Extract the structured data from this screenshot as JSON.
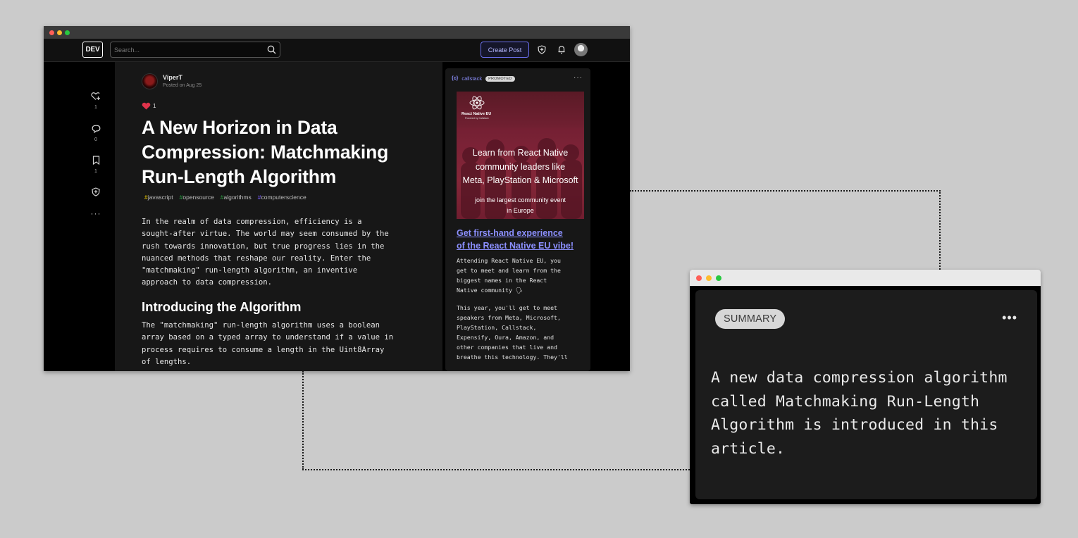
{
  "browser": {
    "nav": {
      "logo": "DEV",
      "search_placeholder": "Search...",
      "create_post": "Create Post"
    },
    "reactions": [
      {
        "name": "heart",
        "count": "1"
      },
      {
        "name": "comment",
        "count": "0"
      },
      {
        "name": "bookmark",
        "count": "1"
      }
    ],
    "article": {
      "author": "ViperT",
      "posted": "Posted on Aug 25",
      "reaction_count": "1",
      "title_lines": [
        "A New Horizon in Data",
        "Compression: Matchmaking",
        "Run-Length Algorithm"
      ],
      "tags": [
        {
          "label": "javascript",
          "color": "#e2c200"
        },
        {
          "label": "opensource",
          "color": "#26a641"
        },
        {
          "label": "algorithms",
          "color": "#2ea043"
        },
        {
          "label": "computerscience",
          "color": "#7a5cff"
        }
      ],
      "para1": [
        "In the realm of data compression, efficiency is a",
        "sought-after virtue. The world may seem consumed by the",
        "rush towards innovation, but true progress lies in the",
        "nuanced methods that reshape our reality. Enter the",
        "\"matchmaking\" run-length algorithm, an inventive",
        "approach to data compression."
      ],
      "heading": "Introducing the Algorithm",
      "para2": [
        "The \"matchmaking\" run-length algorithm uses a boolean",
        "array based on a typed array to understand if a value in",
        "process requires to consume a length in the Uint8Array",
        "of lengths."
      ]
    },
    "ad": {
      "brand": "callstack",
      "brand_icon": "{c}",
      "badge": "PROMOTED",
      "image": {
        "logo_text": "React Native EU",
        "logo_sub": "Powered by Callstack",
        "headline_lines": [
          "Learn from React Native",
          "community leaders like",
          "Meta, PlayStation & Microsoft"
        ],
        "subline_lines": [
          "join the largest community event",
          "in Europe"
        ]
      },
      "link_lines": [
        "Get first-hand experience",
        "of the React Native EU vibe!"
      ],
      "text1": [
        "Attending React Native EU, you",
        "get to meet and learn from the",
        "biggest names in the React",
        "Native community 🗣"
      ],
      "text2": [
        "This year, you'll get to meet",
        "speakers from Meta, Microsoft,",
        "PlayStation, Callstack,",
        "Expensify, Oura, Amazon, and",
        "other companies that live and",
        "breathe this technology. They'll"
      ]
    }
  },
  "summary": {
    "badge": "SUMMARY",
    "text": "A new data compression algorithm called Matchmaking Run-Length Algorithm is introduced in this article."
  }
}
